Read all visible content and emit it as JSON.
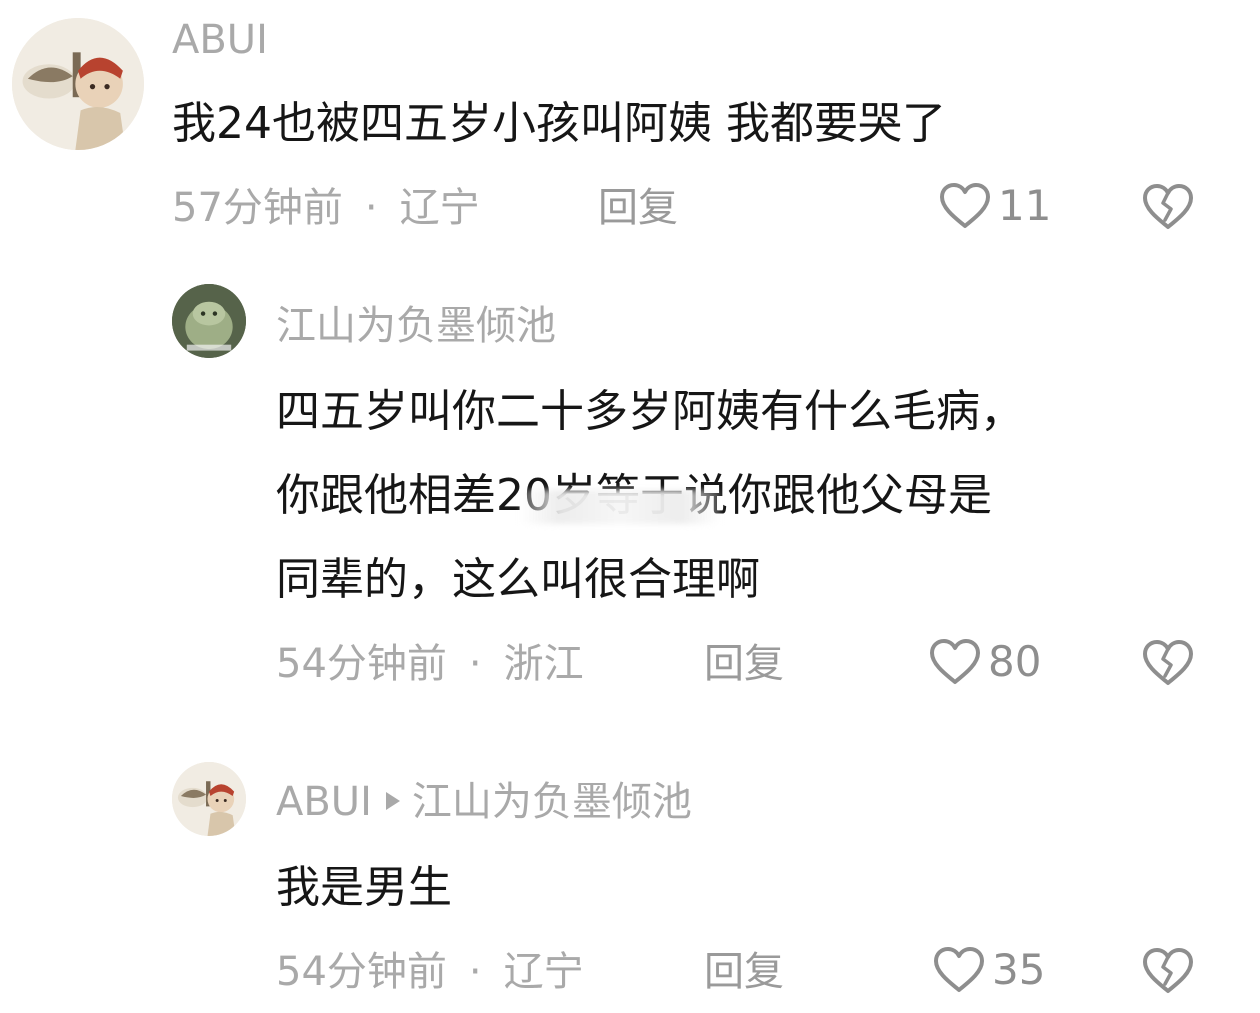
{
  "comments": [
    {
      "user": "ABUI",
      "text": "我24也被四五岁小孩叫阿姨 我都要哭了",
      "time": "57分钟前",
      "location": "辽宁",
      "reply_label": "回复",
      "likes": "11"
    },
    {
      "user": "江山为负墨倾池",
      "text_lines": [
        "四五岁叫你二十多岁阿姨有什么毛病，",
        "你跟他相差20岁等于说你跟他父母是",
        "同辈的，这么叫很合理啊"
      ],
      "time": "54分钟前",
      "location": "浙江",
      "reply_label": "回复",
      "likes": "80"
    },
    {
      "user": "ABUI",
      "reply_to": "江山为负墨倾池",
      "text": "我是男生",
      "time": "54分钟前",
      "location": "辽宁",
      "reply_label": "回复",
      "likes": "35"
    }
  ],
  "meta_separator": "·",
  "icons": {
    "like": "heart-outline-icon",
    "dislike": "broken-heart-icon"
  },
  "colors": {
    "text": "#161616",
    "meta": "#a9a9a9",
    "icon": "#8e8e8e",
    "background": "#ffffff"
  }
}
